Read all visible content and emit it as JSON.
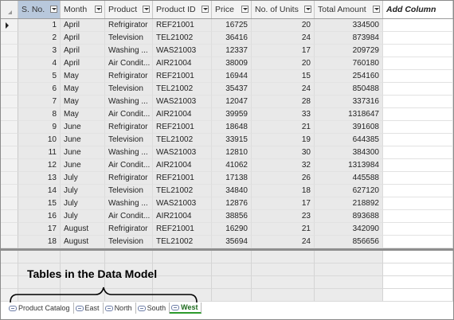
{
  "columns": [
    {
      "label": "S. No.",
      "has_filter": true
    },
    {
      "label": "Month",
      "has_filter": true
    },
    {
      "label": "Product",
      "has_filter": true
    },
    {
      "label": "Product ID",
      "has_filter": true
    },
    {
      "label": "Price",
      "has_filter": true
    },
    {
      "label": "No. of Units",
      "has_filter": true
    },
    {
      "label": "Total Amount",
      "has_filter": true
    },
    {
      "label": "Add Column",
      "has_filter": false
    }
  ],
  "rows": [
    [
      "1",
      "April",
      "Refrigirator",
      "REF21001",
      "16725",
      "20",
      "334500"
    ],
    [
      "2",
      "April",
      "Television",
      "TEL21002",
      "36416",
      "24",
      "873984"
    ],
    [
      "3",
      "April",
      "Washing ...",
      "WAS21003",
      "12337",
      "17",
      "209729"
    ],
    [
      "4",
      "April",
      "Air Condit...",
      "AIR21004",
      "38009",
      "20",
      "760180"
    ],
    [
      "5",
      "May",
      "Refrigirator",
      "REF21001",
      "16944",
      "15",
      "254160"
    ],
    [
      "6",
      "May",
      "Television",
      "TEL21002",
      "35437",
      "24",
      "850488"
    ],
    [
      "7",
      "May",
      "Washing ...",
      "WAS21003",
      "12047",
      "28",
      "337316"
    ],
    [
      "8",
      "May",
      "Air Condit...",
      "AIR21004",
      "39959",
      "33",
      "1318647"
    ],
    [
      "9",
      "June",
      "Refrigirator",
      "REF21001",
      "18648",
      "21",
      "391608"
    ],
    [
      "10",
      "June",
      "Television",
      "TEL21002",
      "33915",
      "19",
      "644385"
    ],
    [
      "11",
      "June",
      "Washing ...",
      "WAS21003",
      "12810",
      "30",
      "384300"
    ],
    [
      "12",
      "June",
      "Air Condit...",
      "AIR21004",
      "41062",
      "32",
      "1313984"
    ],
    [
      "13",
      "July",
      "Refrigirator",
      "REF21001",
      "17138",
      "26",
      "445588"
    ],
    [
      "14",
      "July",
      "Television",
      "TEL21002",
      "34840",
      "18",
      "627120"
    ],
    [
      "15",
      "July",
      "Washing ...",
      "WAS21003",
      "12876",
      "17",
      "218892"
    ],
    [
      "16",
      "July",
      "Air Condit...",
      "AIR21004",
      "38856",
      "23",
      "893688"
    ],
    [
      "17",
      "August",
      "Refrigirator",
      "REF21001",
      "16290",
      "21",
      "342090"
    ],
    [
      "18",
      "August",
      "Television",
      "TEL21002",
      "35694",
      "24",
      "856656"
    ]
  ],
  "annotation": "Tables in the Data Model",
  "tabs": [
    {
      "label": "Product Catalog",
      "active": false
    },
    {
      "label": "East",
      "active": false
    },
    {
      "label": "North",
      "active": false
    },
    {
      "label": "South",
      "active": false
    },
    {
      "label": "West",
      "active": true
    }
  ],
  "colors": {
    "selected_header": "#b8c8dc",
    "active_tab": "#2c9a2c",
    "gray_cells": "#e9e9e9"
  }
}
